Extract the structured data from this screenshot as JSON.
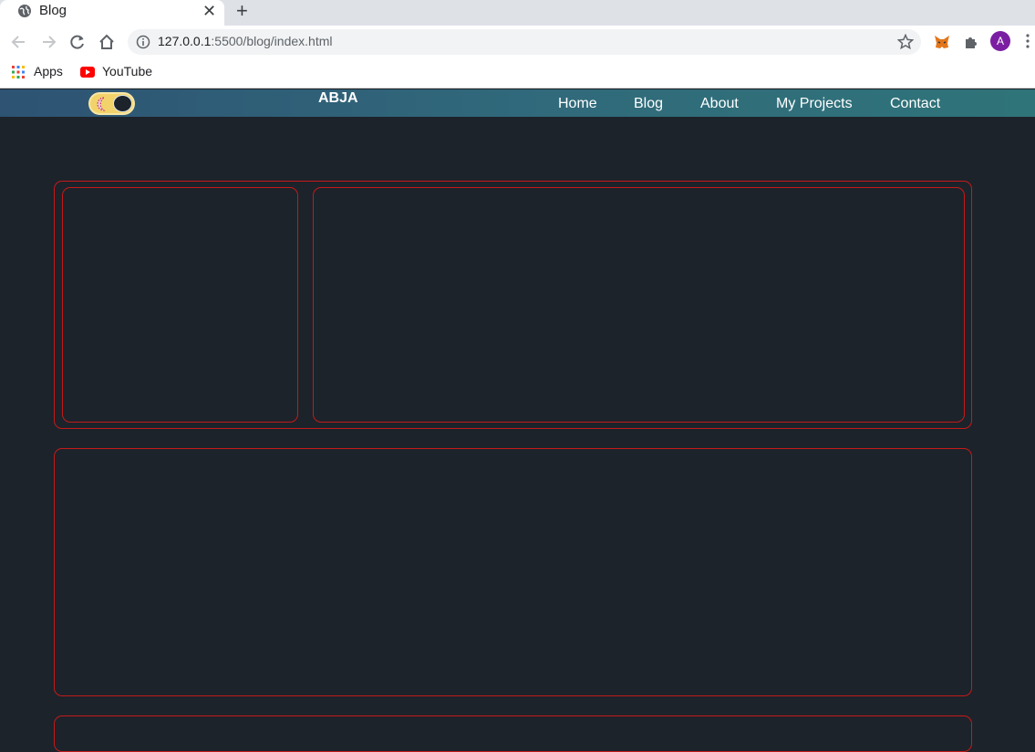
{
  "browser": {
    "tab_title": "Blog",
    "url_host": "127.0.0.1",
    "url_rest": ":5500/blog/index.html",
    "profile_initial": "A",
    "bookmarks": [
      {
        "label": "Apps",
        "icon": "apps-grid-icon"
      },
      {
        "label": "YouTube",
        "icon": "youtube-icon"
      }
    ]
  },
  "site": {
    "brand": "ABJA",
    "nav": [
      {
        "label": "Home"
      },
      {
        "label": "Blog"
      },
      {
        "label": "About"
      },
      {
        "label": "My Projects"
      },
      {
        "label": "Contact"
      }
    ],
    "colors": {
      "background": "#1d232a",
      "card_border": "#c41a1a",
      "nav_gradient_start": "#2e5373",
      "nav_gradient_end": "#2f7479"
    }
  }
}
